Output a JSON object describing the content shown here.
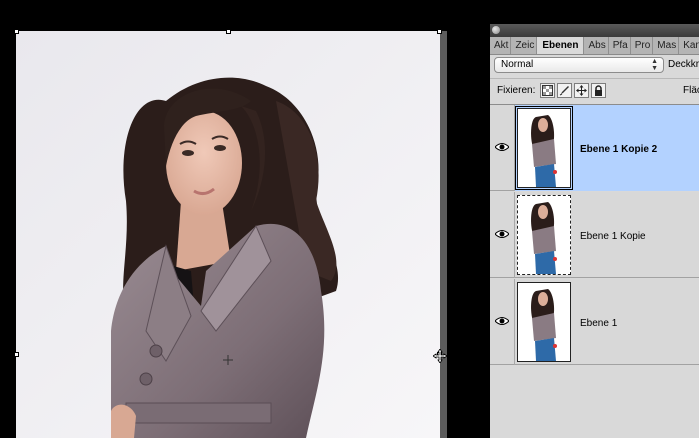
{
  "panel": {
    "tabs": [
      "Akt",
      "Zeic",
      "Ebenen",
      "Abs",
      "Pfa",
      "Pro",
      "Mas",
      "Kan"
    ],
    "active_tab": "Ebenen",
    "blend_mode": "Normal",
    "opacity_label": "Deckkr",
    "lock_label": "Fixieren:",
    "fill_label": "Fläc",
    "layers": [
      {
        "name": "Ebene 1 Kopie 2",
        "visible": true,
        "selected": true
      },
      {
        "name": "Ebene 1 Kopie",
        "visible": true,
        "selected": false
      },
      {
        "name": "Ebene 1",
        "visible": true,
        "selected": false
      }
    ]
  },
  "icons": {
    "eye": "eye-icon",
    "lock_transparency": "lock-transparent-pixels-icon",
    "lock_image": "lock-image-pixels-icon",
    "lock_position": "lock-position-icon",
    "lock_all": "lock-all-icon",
    "move_cursor": "move-cursor-icon"
  },
  "colors": {
    "selection": "#b3d2ff",
    "panel_bg": "#d9d9d9",
    "canvas_bg": "#f1f0f4"
  }
}
